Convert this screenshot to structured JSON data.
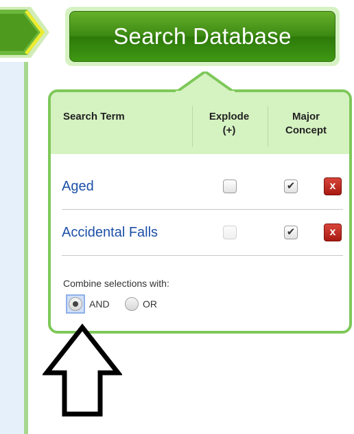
{
  "search_button": {
    "label": "Search Database"
  },
  "table": {
    "headers": {
      "term": "Search Term",
      "explode_line1": "Explode",
      "explode_line2": "(+)",
      "major_line1": "Major",
      "major_line2": "Concept"
    },
    "rows": [
      {
        "term": "Aged",
        "explode_checked": false,
        "explode_enabled": true,
        "major_checked": true,
        "delete_label": "x"
      },
      {
        "term": "Accidental Falls",
        "explode_checked": false,
        "explode_enabled": false,
        "major_checked": true,
        "delete_label": "x"
      }
    ]
  },
  "combine": {
    "label": "Combine selections with:",
    "options": [
      "AND",
      "OR"
    ],
    "selected": "AND"
  },
  "colors": {
    "button_green": "#3d8a14",
    "panel_border": "#7ec85a",
    "header_bg": "#d5f2c1",
    "link_blue": "#1b4fa8",
    "delete_red": "#a81a12"
  },
  "icons": {
    "step_arrow": "chevron-right-icon",
    "annotation": "up-arrow-icon",
    "delete": "close-x-icon"
  }
}
